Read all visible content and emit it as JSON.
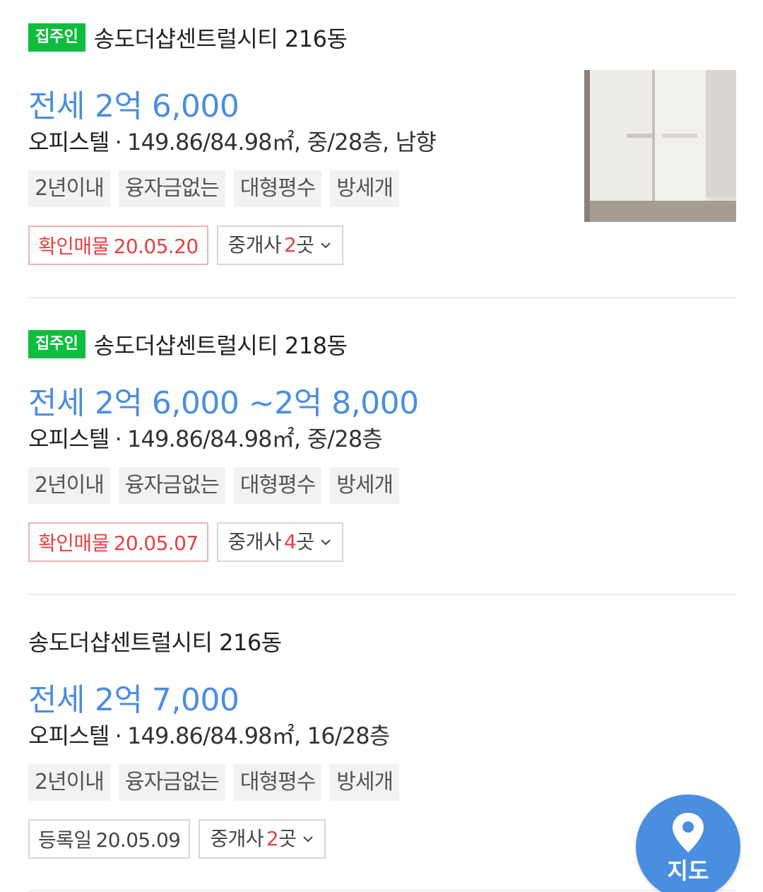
{
  "colors": {
    "owner_badge": "#0fbd3e",
    "price": "#4a8ee0",
    "confirm": "#e84141",
    "map_button": "#4a8ee0"
  },
  "listings": [
    {
      "owner_badge": "집주인",
      "building": "송도더샵센트럴시티 216동",
      "deal_type": "전세",
      "price": "2억 6,000",
      "property_type": "오피스텔",
      "details": "149.86/84.98㎡, 중/28층, 남향",
      "tags": [
        "2년이내",
        "융자금없는",
        "대형평수",
        "방세개"
      ],
      "confirm_label": "확인매물",
      "confirm_date": "20.05.20",
      "broker_prefix": "중개사",
      "broker_count": "2",
      "broker_unit": "곳",
      "has_photo": true
    },
    {
      "owner_badge": "집주인",
      "building": "송도더샵센트럴시티 218동",
      "deal_type": "전세",
      "price": "2억 6,000 ~2억 8,000",
      "property_type": "오피스텔",
      "details": "149.86/84.98㎡, 중/28층",
      "tags": [
        "2년이내",
        "융자금없는",
        "대형평수",
        "방세개"
      ],
      "confirm_label": "확인매물",
      "confirm_date": "20.05.07",
      "broker_prefix": "중개사",
      "broker_count": "4",
      "broker_unit": "곳",
      "has_photo": false
    },
    {
      "owner_badge": "",
      "building": "송도더샵센트럴시티 216동",
      "deal_type": "전세",
      "price": "2억 7,000",
      "property_type": "오피스텔",
      "details": "149.86/84.98㎡, 16/28층",
      "tags": [
        "2년이내",
        "융자금없는",
        "대형평수",
        "방세개"
      ],
      "register_label": "등록일",
      "register_date": "20.05.09",
      "broker_prefix": "중개사",
      "broker_count": "2",
      "broker_unit": "곳",
      "has_photo": false
    }
  ],
  "map_button": {
    "icon": "map-pin-icon",
    "label": "지도"
  }
}
